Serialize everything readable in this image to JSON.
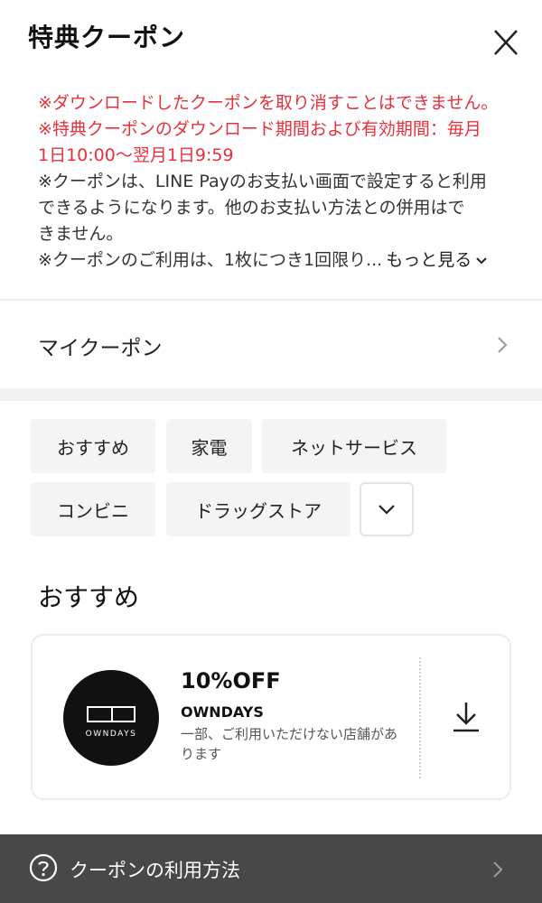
{
  "header": {
    "title": "特典クーポン"
  },
  "notes": {
    "red": [
      "※ダウンロードしたクーポンを取り消すことはできません。",
      "※特典クーポンのダウンロード期間および有効期間：毎月",
      "1日10:00〜翌月1日9:59"
    ],
    "dark": [
      "※クーポンは、LINE Payのお支払い画面で設定すると利用",
      "できるようになります。他のお支払い方法との併用はで",
      "きません。"
    ],
    "last": "※クーポンのご利用は、1枚につき1回限り...",
    "more_label": "もっと見る"
  },
  "mycoupon": {
    "label": "マイクーポン"
  },
  "categories": [
    "おすすめ",
    "家電",
    "ネットサービス",
    "コンビニ",
    "ドラッグストア"
  ],
  "section": {
    "title": "おすすめ"
  },
  "coupon": {
    "logo_text": "OWNDAYS",
    "discount": "10%OFF",
    "brand": "OWNDAYS",
    "note": "一部、ご利用いただけない店舗があります"
  },
  "footer": {
    "label": "クーポンの利用方法"
  },
  "colors": {
    "notice_red": "#e8303c",
    "footer_bg": "#484848"
  }
}
